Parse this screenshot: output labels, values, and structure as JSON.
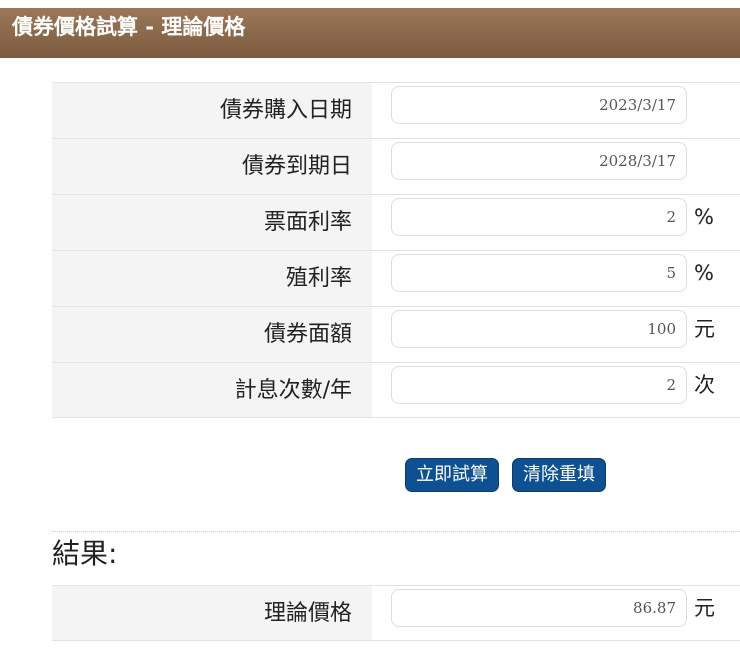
{
  "header": {
    "title": "債券價格試算 - 理論價格"
  },
  "form": {
    "rows": [
      {
        "label": "債券購入日期",
        "value": "2023/3/17",
        "unit": ""
      },
      {
        "label": "債券到期日",
        "value": "2028/3/17",
        "unit": ""
      },
      {
        "label": "票面利率",
        "value": "2",
        "unit": "%"
      },
      {
        "label": "殖利率",
        "value": "5",
        "unit": "%"
      },
      {
        "label": "債券面額",
        "value": "100",
        "unit": "元"
      },
      {
        "label": "計息次數/年",
        "value": "2",
        "unit": "次"
      }
    ]
  },
  "buttons": {
    "calculate": "立即試算",
    "reset": "清除重填"
  },
  "result": {
    "heading": "結果:",
    "label": "理論價格",
    "value": "86.87",
    "unit": "元"
  }
}
